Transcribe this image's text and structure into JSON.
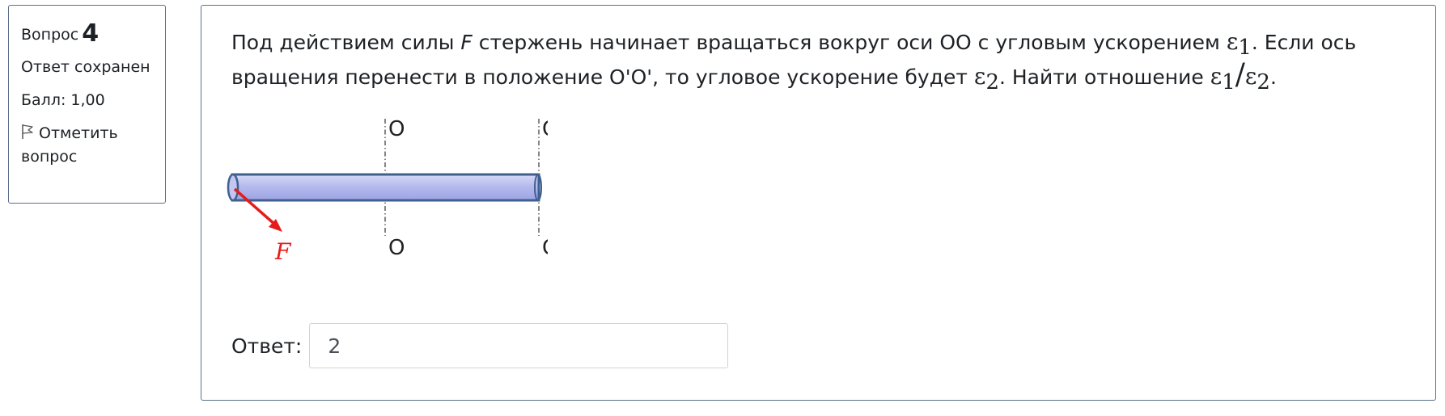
{
  "question_info": {
    "label": "Вопрос",
    "number": "4",
    "state": "Ответ сохранен",
    "grade": "Балл: 1,00",
    "flag_label": "Отметить вопрос"
  },
  "question": {
    "text_part1": "Под действием силы ",
    "force_symbol": "F",
    "text_part2": " стержень начинает вращаться вокруг оси OO с угловым ускорением ",
    "eps": "ε",
    "sub1": "1",
    "text_part3": ". Если ось вращения перенести в положение O'O', то угловое ускорение будет ",
    "sub2": "2",
    "text_part4": ". Найти отношение ",
    "slash": "/",
    "text_part5": "."
  },
  "diagram": {
    "axis1_top": "O",
    "axis1_bottom": "O",
    "axis2_top": "O’",
    "axis2_bottom": "O’",
    "force_label": "F",
    "colors": {
      "rod_fill": "#b3b8ec",
      "rod_stroke": "#3f5f8f",
      "force": "#e51c1c",
      "axis": "#444444"
    }
  },
  "answer": {
    "label": "Ответ:",
    "value": "2"
  }
}
